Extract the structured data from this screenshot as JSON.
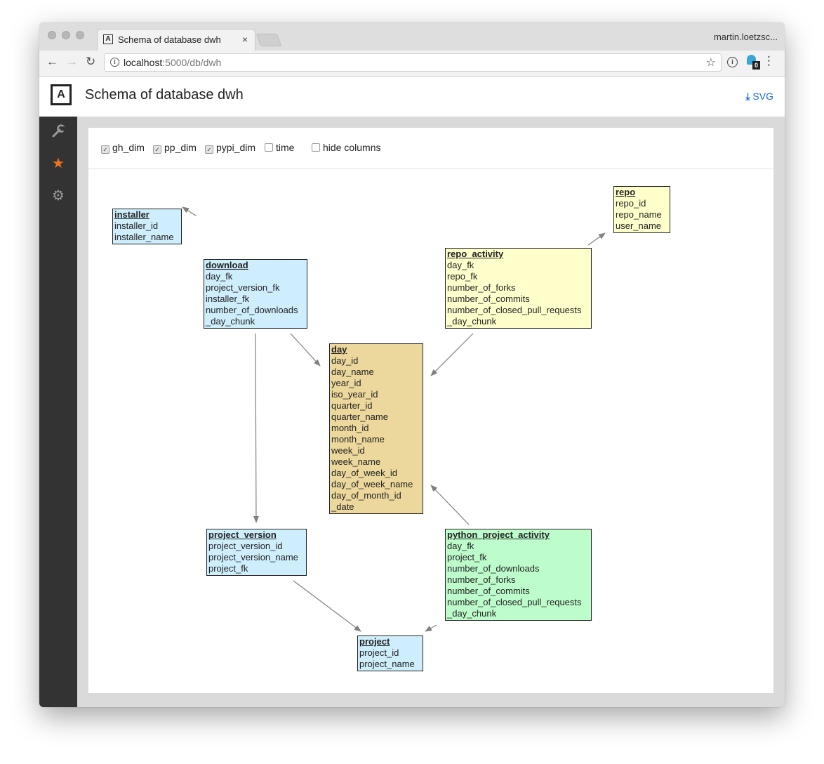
{
  "browser": {
    "tab_title": "Schema of database dwh",
    "tab_favicon": "A",
    "tab_close": "×",
    "profile_name": "martin.loetzsc...",
    "url_host": "localhost",
    "url_path": ":5000/db/dwh",
    "extension_badge": "0"
  },
  "header": {
    "logo": "A",
    "title": "Schema of database dwh",
    "svg_label": "SVG"
  },
  "sidebar": {
    "items": [
      {
        "icon": "wrench-icon",
        "active": false
      },
      {
        "icon": "star-icon",
        "active": true
      },
      {
        "icon": "gear-icon",
        "active": false
      }
    ]
  },
  "filters": [
    {
      "label": "gh_dim",
      "checked": true
    },
    {
      "label": "pp_dim",
      "checked": true
    },
    {
      "label": "pypi_dim",
      "checked": true
    },
    {
      "label": "time",
      "checked": false
    },
    {
      "label": "hide columns",
      "checked": false
    }
  ],
  "colors": {
    "accent": "#f1731f",
    "link": "#1e6fd1",
    "pypi_dim": "#ceeefd",
    "gh_dim": "#ffffcc",
    "time": "#ecd89c",
    "pp_dim": "#bdfdcc",
    "edge": "#808080"
  },
  "entities": {
    "installer": {
      "name": "installer",
      "columns": [
        "installer_id",
        "installer_name"
      ]
    },
    "download": {
      "name": "download",
      "columns": [
        "day_fk",
        "project_version_fk",
        "installer_fk",
        "number_of_downloads",
        "_day_chunk"
      ]
    },
    "repo": {
      "name": "repo",
      "columns": [
        "repo_id",
        "repo_name",
        "user_name"
      ]
    },
    "repo_activity": {
      "name": "repo_activity",
      "columns": [
        "day_fk",
        "repo_fk",
        "number_of_forks",
        "number_of_commits",
        "number_of_closed_pull_requests",
        "_day_chunk"
      ]
    },
    "day": {
      "name": "day",
      "columns": [
        "day_id",
        "day_name",
        "year_id",
        "iso_year_id",
        "quarter_id",
        "quarter_name",
        "month_id",
        "month_name",
        "week_id",
        "week_name",
        "day_of_week_id",
        "day_of_week_name",
        "day_of_month_id",
        "_date"
      ]
    },
    "project_version": {
      "name": "project_version",
      "columns": [
        "project_version_id",
        "project_version_name",
        "project_fk"
      ]
    },
    "python_project_activity": {
      "name": "python_project_activity",
      "columns": [
        "day_fk",
        "project_fk",
        "number_of_downloads",
        "number_of_forks",
        "number_of_commits",
        "number_of_closed_pull_requests",
        "_day_chunk"
      ]
    },
    "project": {
      "name": "project",
      "columns": [
        "project_id",
        "project_name"
      ]
    }
  }
}
